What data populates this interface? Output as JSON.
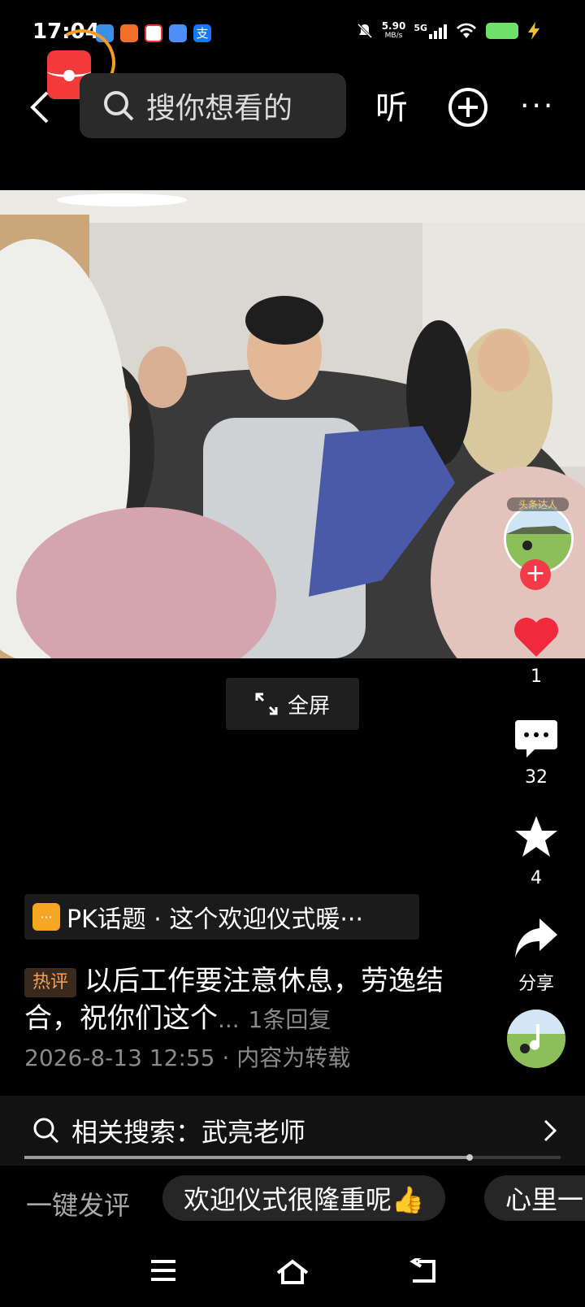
{
  "status_bar": {
    "time": "17:04",
    "net_speed_top": "5.90",
    "net_speed_bottom": "MB/s",
    "network": "5G",
    "icons": [
      "app-icon-blue",
      "app-icon-orange",
      "app-icon-red",
      "app-icon-blue2",
      "alipay-icon",
      "mute-icon",
      "signal-icon",
      "wifi-icon",
      "battery-icon",
      "charging-icon"
    ]
  },
  "top_bar": {
    "search_placeholder": "搜你想看的",
    "listen_label": "听",
    "more_label": "···"
  },
  "video": {
    "fullscreen_label": "全屏"
  },
  "actions": {
    "like_count": "1",
    "comment_count": "32",
    "favorite_count": "4",
    "share_label": "分享",
    "author_badge": "头条达人",
    "like_color": "#f0293c"
  },
  "post": {
    "pk_topic": "PK话题 · 这个欢迎仪式暖···",
    "hot_tag": "热评",
    "comment_text": "以后工作要注意休息，劳逸结合，祝你们这个",
    "ellipsis": "...",
    "reply_count": "1条回复",
    "date_line": "2026-8-13 12:55 · 内容为转载"
  },
  "related": {
    "label": "相关搜索：武亮老师"
  },
  "progress": {
    "value": 0.83
  },
  "quick_comment": {
    "label": "一键发评",
    "chips": [
      "欢迎仪式很隆重呢👍",
      "心里一"
    ]
  }
}
